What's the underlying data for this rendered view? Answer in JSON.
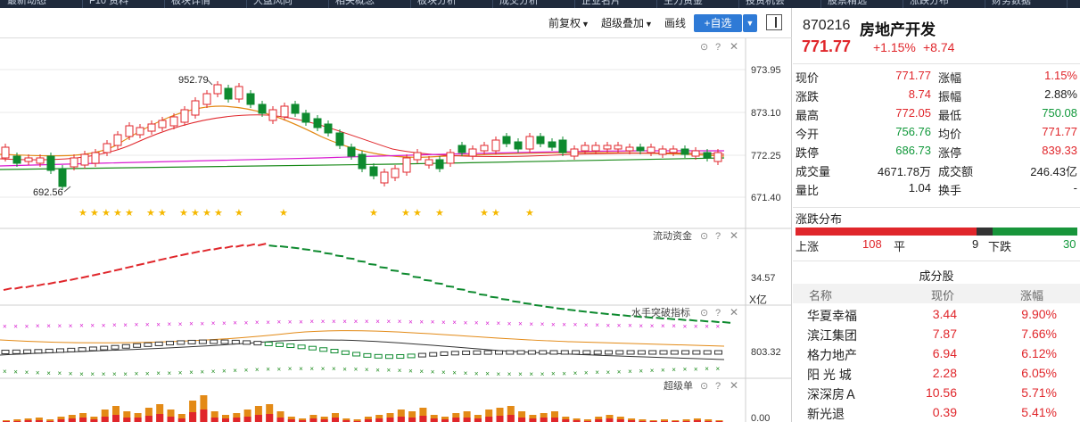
{
  "nav_tabs": [
    "最新动态",
    "F10 资料",
    "板块详情",
    "大盘风向",
    "相关概念",
    "板块分析",
    "成交分析",
    "企业名片",
    "主力资金",
    "投资机会",
    "股票精选",
    "涨跌分布",
    "财务数据"
  ],
  "toolbar": {
    "fuquan": "前复权",
    "overlay": "超级叠加",
    "draw": "画线",
    "add_favorite": "+自选"
  },
  "chart": {
    "price_axis": [
      "973.95",
      "873.10",
      "772.25",
      "671.40"
    ],
    "high_label": "952.79",
    "low_label": "692.56",
    "capital_flow_title": "流动资金",
    "capital_flow_value": "34.57",
    "capital_flow_unit": "X亿",
    "waterman_title": "水手突破指标",
    "waterman_value": "803.32",
    "super_order_title": "超级单",
    "super_order_value": "0.00",
    "colors": {
      "up": "#e0262b",
      "down": "#0e8a2f",
      "ma_orange": "#e38a16",
      "ma_pink": "#d81bd0",
      "ma_green": "#1a8a1a",
      "star": "#f5b800"
    }
  },
  "quote": {
    "code": "870216",
    "name": "房地产开发",
    "price": "771.77",
    "change_pct": "+1.15%",
    "change": "+8.74",
    "stats": [
      {
        "l1": "现价",
        "v1": "771.77",
        "c1": "red",
        "l2": "涨幅",
        "v2": "1.15%",
        "c2": "red"
      },
      {
        "l1": "涨跌",
        "v1": "8.74",
        "c1": "red",
        "l2": "振幅",
        "v2": "2.88%",
        "c2": "dark"
      },
      {
        "l1": "最高",
        "v1": "772.05",
        "c1": "red",
        "l2": "最低",
        "v2": "750.08",
        "c2": "green"
      },
      {
        "l1": "今开",
        "v1": "756.76",
        "c1": "green",
        "l2": "均价",
        "v2": "771.77",
        "c2": "red"
      },
      {
        "l1": "跌停",
        "v1": "686.73",
        "c1": "green",
        "l2": "涨停",
        "v2": "839.33",
        "c2": "red"
      },
      {
        "l1": "成交量",
        "v1": "4671.78万",
        "c1": "dark",
        "l2": "成交额",
        "v2": "246.43亿",
        "c2": "dark"
      },
      {
        "l1": "量比",
        "v1": "1.04",
        "c1": "dark",
        "l2": "换手",
        "v2": "-",
        "c2": "dark"
      }
    ],
    "distribution": {
      "title": "涨跌分布",
      "up_label": "上涨",
      "up_count": "108",
      "flat_label": "平",
      "flat_count": "9",
      "down_label": "下跌",
      "down_count": "30"
    },
    "components": {
      "title": "成分股",
      "headers": [
        "名称",
        "现价",
        "涨幅"
      ],
      "rows": [
        [
          "华夏幸福",
          "3.44",
          "9.90%"
        ],
        [
          "滨江集团",
          "7.87",
          "7.66%"
        ],
        [
          "格力地产",
          "6.94",
          "6.12%"
        ],
        [
          "阳 光 城",
          "2.28",
          "6.05%"
        ],
        [
          "深深房Ａ",
          "10.56",
          "5.71%"
        ],
        [
          "新光退",
          "0.39",
          "5.41%"
        ]
      ]
    }
  }
}
